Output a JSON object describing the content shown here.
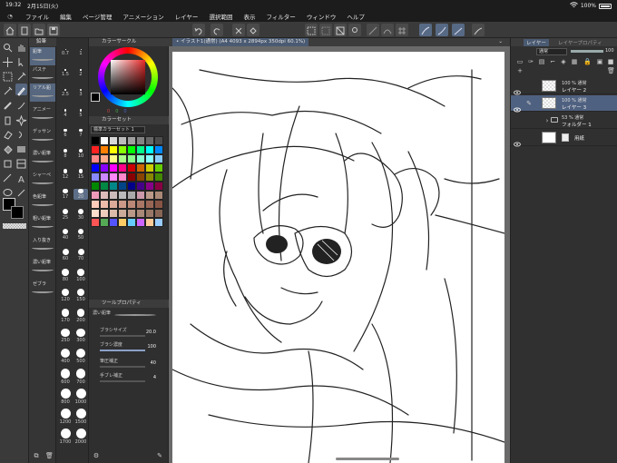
{
  "status": {
    "time": "19:32",
    "date": "2月15日(火)",
    "battery": "100%"
  },
  "menu": {
    "items": [
      "ファイル",
      "編集",
      "ページ管理",
      "アニメーション",
      "レイヤー",
      "選択範囲",
      "表示",
      "フィルター",
      "ウィンドウ",
      "ヘルプ"
    ]
  },
  "subtool": {
    "header": "鉛筆",
    "items": [
      "鉛筆",
      "パステ",
      "リアル鉛",
      "",
      "",
      "アニメー",
      "",
      "デッサン",
      "",
      "濃い鉛筆",
      "",
      "シャーペ",
      "",
      "色鉛筆",
      "",
      "粗い鉛筆",
      "",
      "入り抜き",
      "",
      "濃い鉛筆",
      "",
      "ゼブラ"
    ]
  },
  "sizes": {
    "values": [
      "0.7",
      "1",
      "1.5",
      "2",
      "2.5",
      "3",
      "4",
      "5",
      "6",
      "7",
      "8",
      "10",
      "12",
      "15",
      "17",
      "20",
      "25",
      "30",
      "40",
      "50",
      "60",
      "70",
      "80",
      "100",
      "120",
      "150",
      "170",
      "200",
      "250",
      "300",
      "400",
      "500",
      "600",
      "700",
      "800",
      "1000",
      "1200",
      "1500",
      "1700",
      "2000"
    ],
    "selected": "20"
  },
  "color_panel": {
    "wheel_title": "カラーサークル",
    "set_title": "カラーセット",
    "set_name": "標準カラーセット 1",
    "hsv": [
      "0",
      "0",
      "0"
    ]
  },
  "tool_property": {
    "title": "ツールプロパティ",
    "brush_name": "濃い鉛筆",
    "brush_size_label": "ブラシサイズ",
    "brush_size_value": "20.0",
    "opacity_label": "ブラシ濃度",
    "opacity_value": "100",
    "stabilization_label": "筆圧補正",
    "stabilization_value": "40",
    "blur_label": "手ブレ補正",
    "blur_value": "4"
  },
  "document": {
    "tab_title": "• イラスト1(通常) (A4 4093 x 2894px 350dpi 60.1%)"
  },
  "layers": {
    "tab_label": "レイヤー",
    "tab2_label": "レイヤープロパティ",
    "blend_mode": "通常",
    "opacity": "100",
    "rows": [
      {
        "line1": "100 % 通常",
        "line2": "レイヤー 2",
        "selected": false,
        "type": "raster"
      },
      {
        "line1": "100 % 通常",
        "line2": "レイヤー 3",
        "selected": true,
        "type": "raster"
      },
      {
        "line1": "53 % 通常",
        "line2": "フォルダー 1",
        "selected": false,
        "type": "folder"
      },
      {
        "line1": "",
        "line2": "用紙",
        "selected": false,
        "type": "paper"
      }
    ]
  },
  "colors": {
    "accent": "#56677f",
    "panel": "#303030",
    "canvas_bg": "#6a6a6a"
  }
}
